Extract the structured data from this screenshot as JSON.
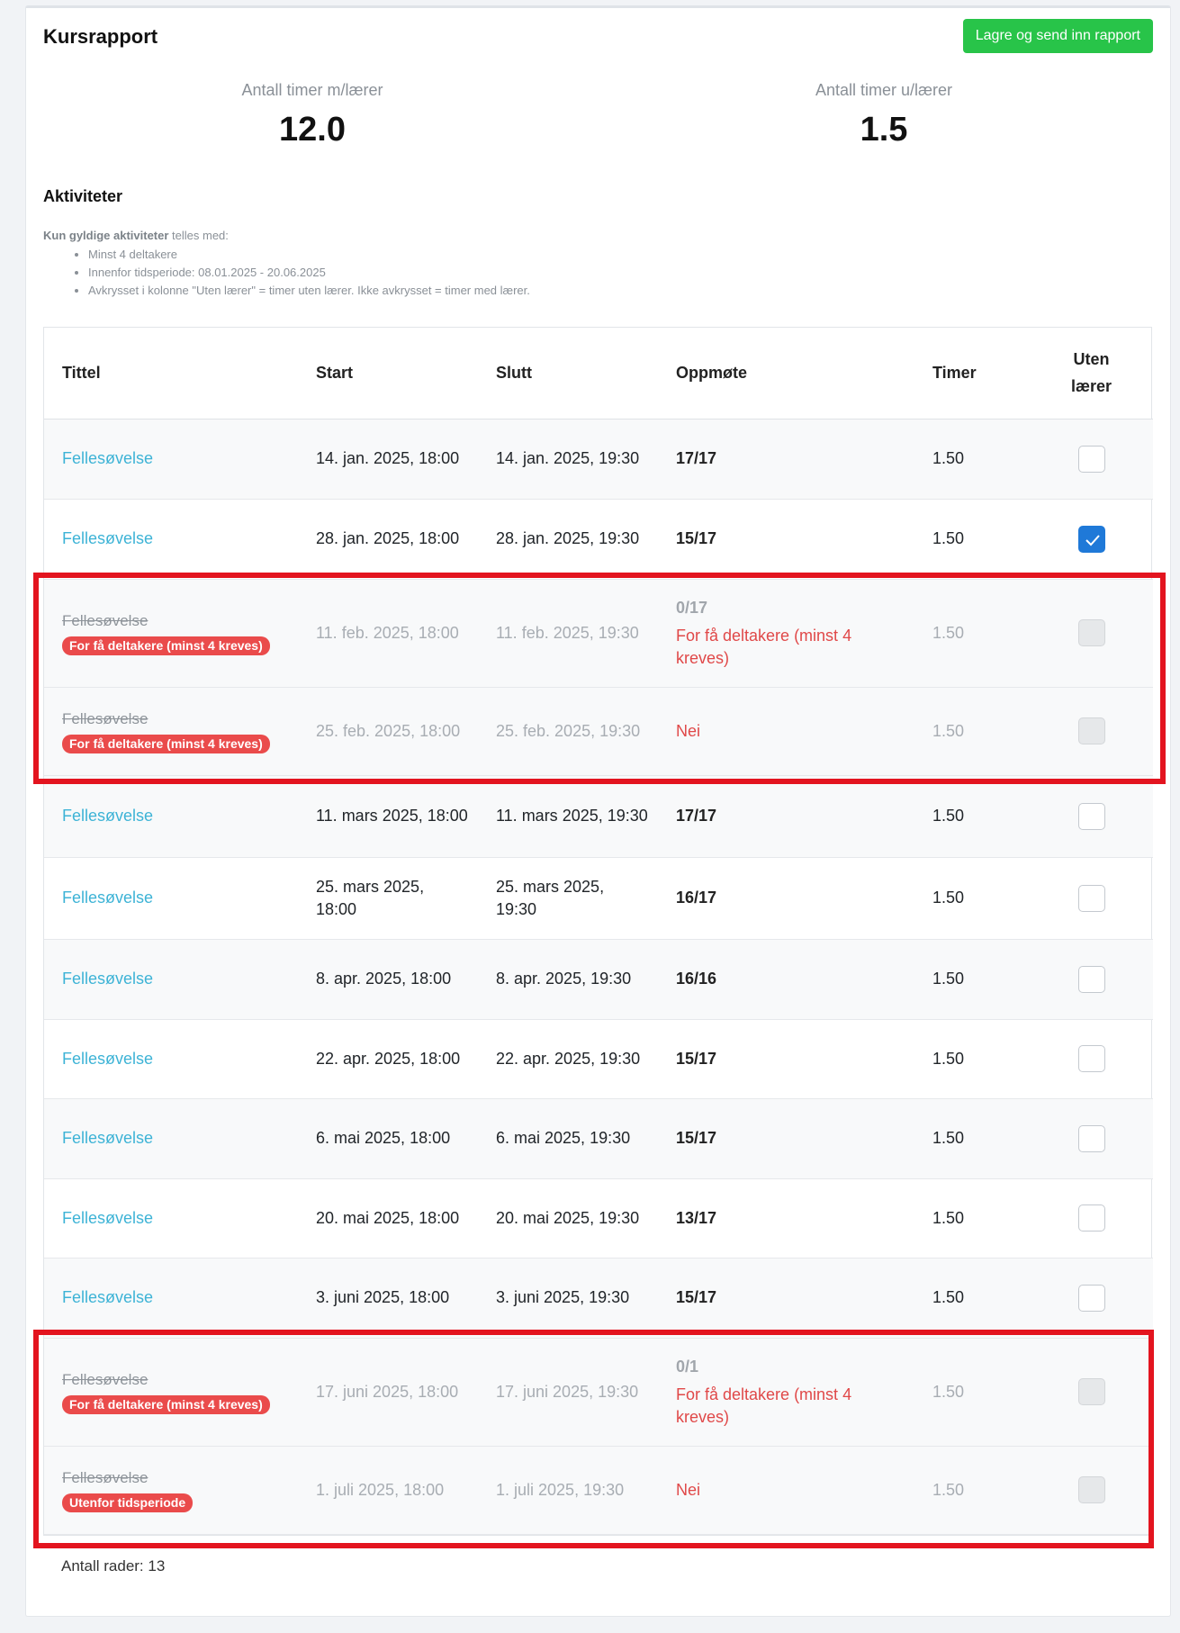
{
  "header": {
    "title": "Kursrapport",
    "submit_label": "Lagre og send inn rapport"
  },
  "stats": {
    "with_teacher": {
      "label": "Antall timer m/lærer",
      "value": "12.0"
    },
    "without_teacher": {
      "label": "Antall timer u/lærer",
      "value": "1.5"
    }
  },
  "activities": {
    "heading": "Aktiviteter",
    "rules_bold": "Kun gyldige aktiviteter",
    "rules_rest": " telles med:",
    "rules": [
      "Minst 4 deltakere",
      "Innenfor tidsperiode: 08.01.2025 - 20.06.2025",
      "Avkrysset i kolonne \"Uten lærer\" = timer uten lærer. Ikke avkrysset = timer med lærer."
    ]
  },
  "table": {
    "columns": {
      "title": "Tittel",
      "start": "Start",
      "end": "Slutt",
      "attendance": "Oppmøte",
      "hours": "Timer",
      "no_teacher_1": "Uten",
      "no_teacher_2": "lærer"
    },
    "rows": [
      {
        "title": "Fellesøvelse",
        "start": "14. jan. 2025, 18:00",
        "end": "14. jan. 2025, 19:30",
        "attendance": "17/17",
        "hours": "1.50",
        "checked": false
      },
      {
        "title": "Fellesøvelse",
        "start": "28. jan. 2025, 18:00",
        "end": "28. jan. 2025, 19:30",
        "attendance": "15/17",
        "hours": "1.50",
        "checked": true
      },
      {
        "title": "Fellesøvelse",
        "badge": "For få deltakere (minst 4 kreves)",
        "start": "11. feb. 2025, 18:00",
        "end": "11. feb. 2025, 19:30",
        "attendance": "0/17",
        "attendance_note": "For få deltakere (minst 4 kreves)",
        "hours": "1.50"
      },
      {
        "title": "Fellesøvelse",
        "badge": "For få deltakere (minst 4 kreves)",
        "start": "25. feb. 2025, 18:00",
        "end": "25. feb. 2025, 19:30",
        "attendance_note": "Nei",
        "hours": "1.50"
      },
      {
        "title": "Fellesøvelse",
        "start": "11. mars 2025, 18:00",
        "end": "11. mars 2025, 19:30",
        "attendance": "17/17",
        "hours": "1.50",
        "checked": false
      },
      {
        "title": "Fellesøvelse",
        "start": "25. mars 2025, 18:00",
        "end": "25. mars 2025, 19:30",
        "attendance": "16/17",
        "hours": "1.50",
        "checked": false
      },
      {
        "title": "Fellesøvelse",
        "start": "8. apr. 2025, 18:00",
        "end": "8. apr. 2025, 19:30",
        "attendance": "16/16",
        "hours": "1.50",
        "checked": false
      },
      {
        "title": "Fellesøvelse",
        "start": "22. apr. 2025, 18:00",
        "end": "22. apr. 2025, 19:30",
        "attendance": "15/17",
        "hours": "1.50",
        "checked": false
      },
      {
        "title": "Fellesøvelse",
        "start": "6. mai 2025, 18:00",
        "end": "6. mai 2025, 19:30",
        "attendance": "15/17",
        "hours": "1.50",
        "checked": false
      },
      {
        "title": "Fellesøvelse",
        "start": "20. mai 2025, 18:00",
        "end": "20. mai 2025, 19:30",
        "attendance": "13/17",
        "hours": "1.50",
        "checked": false
      },
      {
        "title": "Fellesøvelse",
        "start": "3. juni 2025, 18:00",
        "end": "3. juni 2025, 19:30",
        "attendance": "15/17",
        "hours": "1.50",
        "checked": false
      },
      {
        "title": "Fellesøvelse",
        "badge": "For få deltakere (minst 4 kreves)",
        "start": "17. juni 2025, 18:00",
        "end": "17. juni 2025, 19:30",
        "attendance": "0/1",
        "attendance_note": "For få deltakere (minst 4 kreves)",
        "hours": "1.50"
      },
      {
        "title": "Fellesøvelse",
        "badge": "Utenfor tidsperiode",
        "start": "1. juli 2025, 18:00",
        "end": "1. juli 2025, 19:30",
        "attendance_note": "Nei",
        "hours": "1.50"
      }
    ]
  },
  "footer": {
    "row_count": "Antall rader: 13"
  },
  "colors": {
    "accent": "#3db3d6",
    "success": "#28c449",
    "danger": "#ea4b4b",
    "checkbox_checked": "#1f79d8",
    "highlight": "#e3141f"
  }
}
